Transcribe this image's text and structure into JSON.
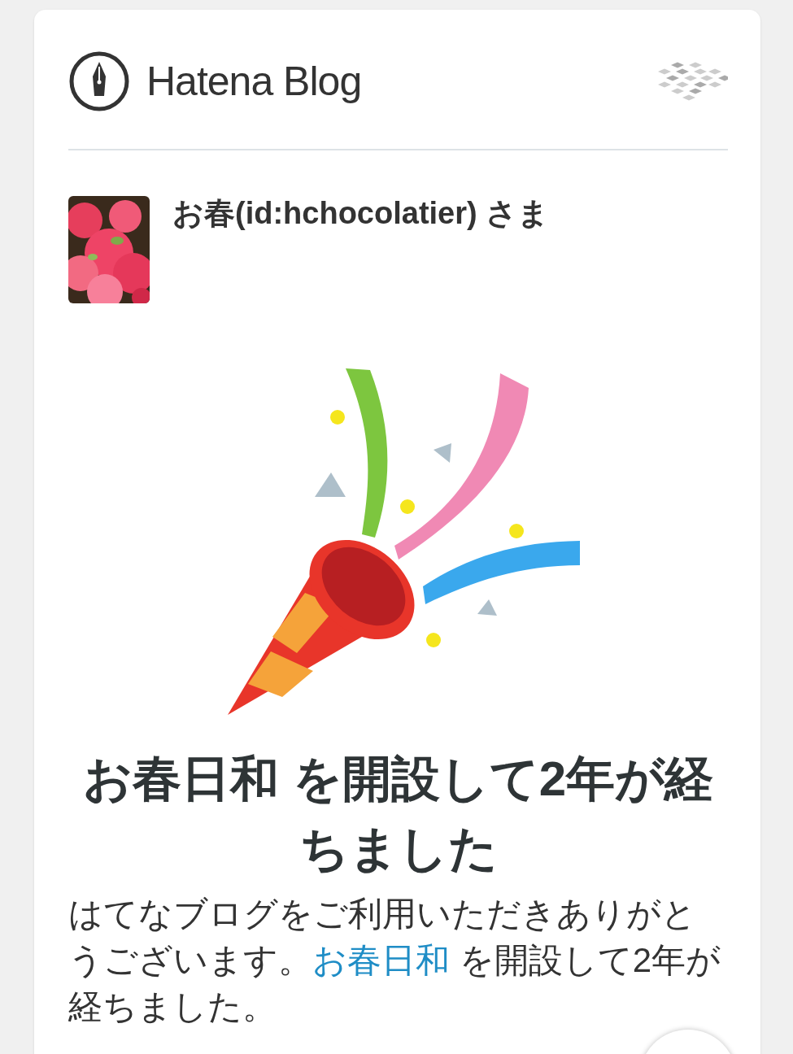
{
  "header": {
    "brand": "Hatena Blog"
  },
  "user": {
    "name": "お春(id:hchocolatier) さま"
  },
  "heading": "お春日和 を開設して2年が経ちました",
  "message": {
    "before": "はてなブログをご利用いただきありがとうございます。",
    "link": "お春日和",
    "after": " を開設して2年が経ちました。"
  }
}
